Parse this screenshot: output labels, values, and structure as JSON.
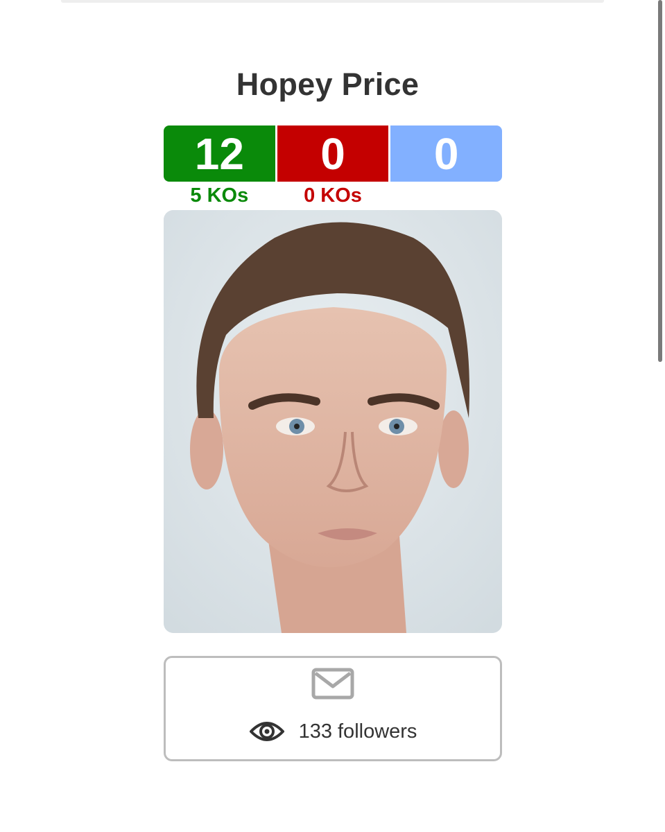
{
  "profile": {
    "name": "Hopey Price"
  },
  "record": {
    "wins": "12",
    "losses": "0",
    "draws": "0",
    "win_kos": "5 KOs",
    "loss_kos": "0 KOs"
  },
  "colors": {
    "win": "#0a8a0a",
    "loss": "#c40000",
    "draw": "#82b0ff"
  },
  "photo": {
    "icon": "fighter-portrait"
  },
  "actions": {
    "message_icon": "envelope-icon",
    "followers_icon": "eye-icon",
    "followers_text": "133 followers"
  }
}
